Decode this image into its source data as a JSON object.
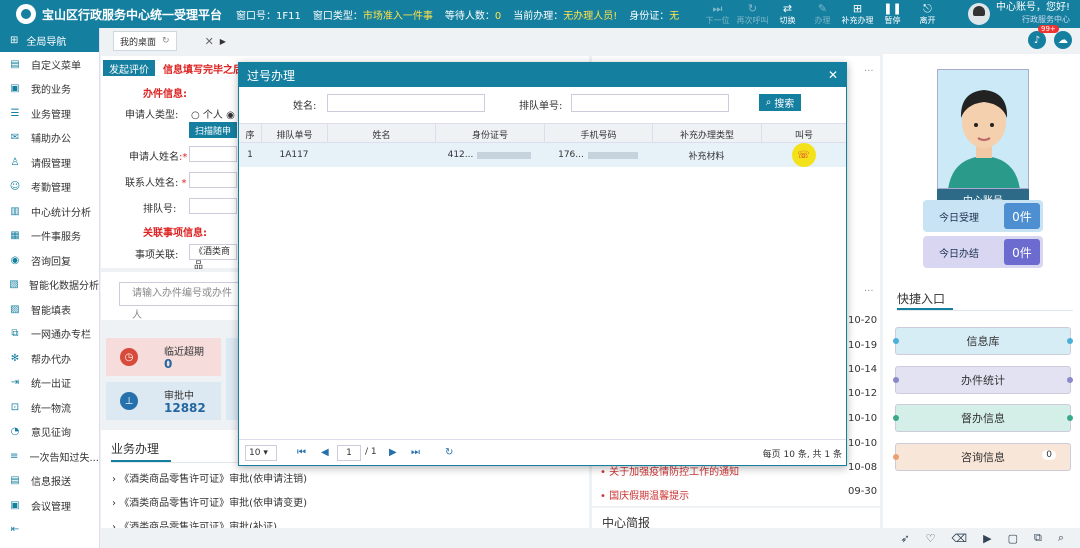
{
  "top": {
    "title": "宝山区行政服务中心统一受理平台",
    "window_label": "窗口号：",
    "window_value": "1F11",
    "type_label": "窗口类型：",
    "type_value": "市场准入一件事",
    "wait_label": "等待人数：",
    "wait_value": "0",
    "current_label": "当前办理：",
    "current_value": "无办理人员!",
    "id_label": "身份证：",
    "id_value": "无",
    "buttons": [
      "下一位",
      "再次呼叫",
      "切换",
      "办理",
      "补充办理",
      "暂停",
      "离开"
    ],
    "user_name": "中心账号，您好!",
    "user_org": "行政服务中心"
  },
  "sidebar": {
    "header": "全局导航",
    "items": [
      "自定义菜单",
      "我的业务",
      "业务管理",
      "辅助办公",
      "请假管理",
      "考勤管理",
      "中心统计分析",
      "一件事服务",
      "咨询回复",
      "智能化数据分析",
      "智能填表",
      "一网通办专栏",
      "帮办代办",
      "统一出证",
      "统一物流",
      "意见征询",
      "一次告知过失...",
      "信息报送",
      "会议管理"
    ]
  },
  "tabs": {
    "home": "我的桌面",
    "notification_count": "99+"
  },
  "form": {
    "eval_button": "发起评价",
    "warning": "信息填写完毕之后",
    "section_applicant": "办件信息:",
    "applicant_type_label": "申请人类型:",
    "applicant_type_opt": "个人",
    "scan_button": "扫描随申",
    "applicant_name_label": "申请人姓名",
    "contact_name_label": "联系人姓名:",
    "queue_label": "排队号:",
    "section_related": "关联事项信息:",
    "related_label": "事项关联:",
    "related_value": "《酒类商品",
    "search_placeholder": "请输入办件编号或办件人"
  },
  "stats": {
    "near_label": "临近超期",
    "near_value": "0",
    "approving_label": "审批中",
    "approving_value": "12882"
  },
  "business": {
    "title": "业务办理",
    "items": [
      "《酒类商品零售许可证》审批(依申请注销)",
      "《酒类商品零售许可证》审批(依申请变更)",
      "《酒类商品零售许可证》审批(补证)"
    ]
  },
  "news": {
    "item1": "关于加强疫情防控工作的通知",
    "item2": "国庆假期温馨提示",
    "dates": [
      "10-20",
      "10-19",
      "10-14",
      "10-12",
      "10-10",
      "10-10",
      "10-08",
      "09-30"
    ],
    "brief_title": "中心简报"
  },
  "profile": {
    "name": "中心账号",
    "today_accept_label": "今日受理",
    "today_accept_value": "0件",
    "today_done_label": "今日办结",
    "today_done_value": "0件"
  },
  "quick": {
    "title": "快捷入口",
    "items": [
      "信息库",
      "办件统计",
      "督办信息",
      "咨询信息"
    ],
    "consult_count": "0"
  },
  "modal": {
    "title": "过号办理",
    "name_label": "姓名:",
    "queue_label": "排队单号:",
    "search_button": "搜索",
    "columns": [
      "序",
      "排队单号",
      "姓名",
      "身份证号",
      "手机号码",
      "补充办理类型",
      "叫号"
    ],
    "row": {
      "index": "1",
      "queue": "1A117",
      "name": "",
      "id": "412...",
      "phone": "176...",
      "type": "补充材料"
    },
    "page_size": "10",
    "page_current": "1",
    "page_total": "/ 1",
    "summary": "每页 10 条, 共 1 条"
  }
}
